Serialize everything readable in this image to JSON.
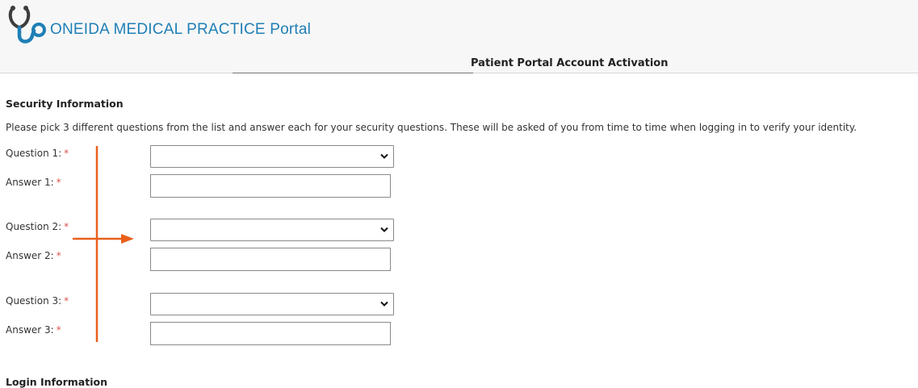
{
  "header": {
    "brand": "ONEIDA MEDICAL PRACTICE Portal",
    "page_title": "Patient Portal Account Activation"
  },
  "security": {
    "title": "Security Information",
    "instructions": "Please pick 3 different questions from the list and answer each for your security questions. These will be asked of you from time to time when logging in to verify your identity.",
    "required_marker": "*",
    "fields": [
      {
        "question_label": "Question 1:",
        "question_value": "",
        "answer_label": "Answer 1:",
        "answer_value": ""
      },
      {
        "question_label": "Question 2:",
        "question_value": "",
        "answer_label": "Answer 2:",
        "answer_value": ""
      },
      {
        "question_label": "Question 3:",
        "question_value": "",
        "answer_label": "Answer 3:",
        "answer_value": ""
      }
    ]
  },
  "next_section_title": "Login Information",
  "colors": {
    "brand": "#1f7fb6",
    "annotation": "#e8601c",
    "required": "#d9534f"
  },
  "icons": {
    "logo": "stethoscope-icon",
    "dropdown": "chevron-down-icon"
  }
}
